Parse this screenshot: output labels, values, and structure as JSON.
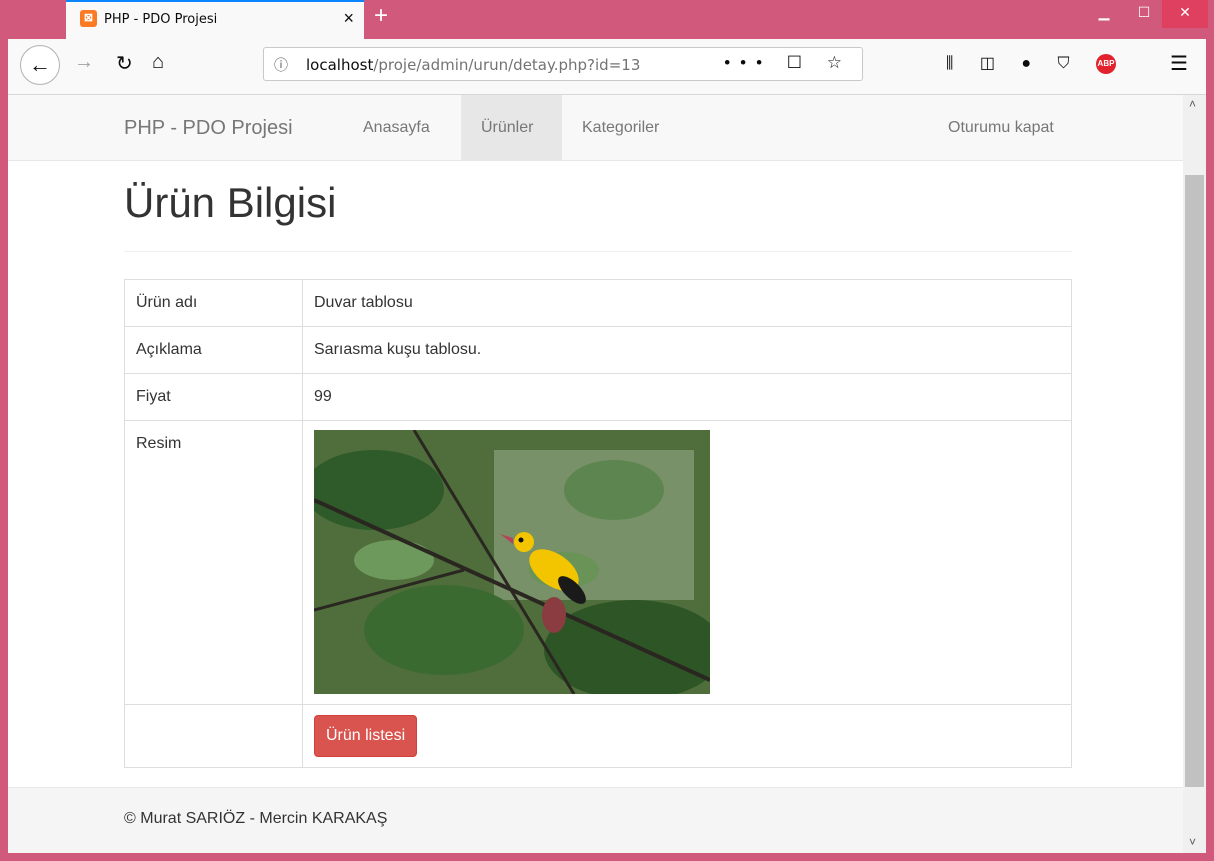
{
  "browser": {
    "tab_title": "PHP - PDO Projesi",
    "tab_close": "×",
    "new_tab": "+",
    "url_host": "localhost",
    "url_path": "/proje/admin/urun/detay.php?id=13",
    "url_actions": "••• ☐ ☆",
    "abp_label": "ABP"
  },
  "site": {
    "brand": "PHP - PDO Projesi",
    "nav": [
      "Anasayfa",
      "Ürünler",
      "Kategoriler"
    ],
    "active_nav": "Ürünler",
    "logout": "Oturumu kapat"
  },
  "page": {
    "title": "Ürün Bilgisi",
    "rows": [
      {
        "label": "Ürün adı",
        "value": "Duvar tablosu"
      },
      {
        "label": "Açıklama",
        "value": "Sarıasma kuşu tablosu."
      },
      {
        "label": "Fiyat",
        "value": "99"
      },
      {
        "label": "Resim",
        "value": ""
      }
    ],
    "list_button": "Ürün listesi"
  },
  "footer": {
    "text": "© Murat SARIÖZ - Mercin KARAKAŞ"
  },
  "colors": {
    "window_frame": "#d15a7c",
    "danger_button": "#d9534f",
    "bird_yellow": "#f2c500"
  }
}
